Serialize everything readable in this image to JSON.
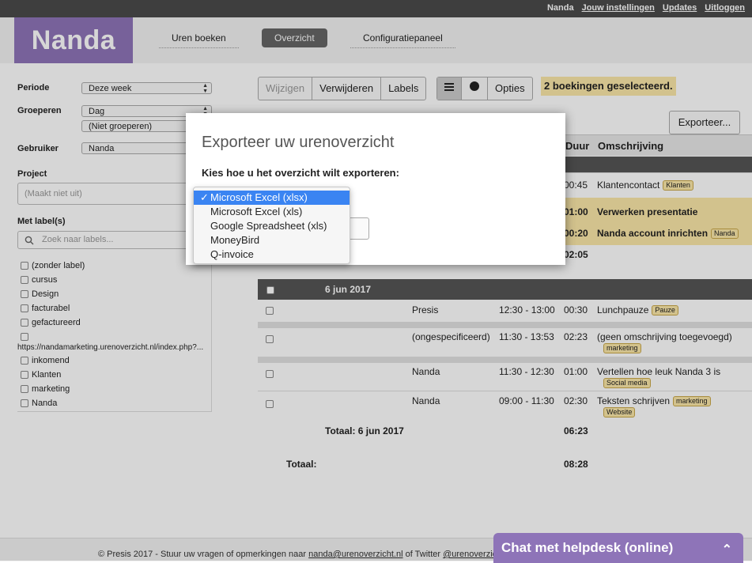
{
  "topbar": {
    "user": "Nanda",
    "settings": "Jouw instellingen",
    "updates": "Updates",
    "logout": "Uitloggen"
  },
  "logo": "Nanda",
  "nav": {
    "book_hours": "Uren boeken",
    "overview": "Overzicht",
    "config": "Configuratiepaneel"
  },
  "filters": {
    "period_label": "Periode",
    "period_value": "Deze week",
    "group_label": "Groeperen",
    "group_value": "Dag",
    "group_value2": "(Niet groeperen)",
    "user_label": "Gebruiker",
    "user_value": "Nanda",
    "project_label": "Project",
    "project_placeholder": "(Maakt niet uit)",
    "labels_label": "Met label(s)",
    "labels_placeholder": "Zoek naar labels...",
    "label_items": [
      "(zonder label)",
      "cursus",
      "Design",
      "facturabel",
      "gefactureerd",
      "",
      "https://nandamarketing.urenoverzicht.nl/index.php?...",
      "inkomend",
      "Klanten",
      "marketing",
      "Nanda"
    ]
  },
  "toolbar": {
    "edit": "Wijzigen",
    "delete": "Verwijderen",
    "labels": "Labels",
    "options": "Opties",
    "notice": "2 boekingen geselecteerd.",
    "export": "Exporteer..."
  },
  "table": {
    "col_duration": "Duur",
    "col_description": "Omschrijving",
    "group1_rows": [
      {
        "duration": "00:45",
        "description": "Klantencontact",
        "tag": "Klanten"
      },
      {
        "duration": "01:00",
        "description": "Verwerken presentatie",
        "tag": ""
      },
      {
        "duration": "00:20",
        "description": "Nanda account inrichten",
        "tag": "Nanda"
      }
    ],
    "group1_total": "02:05",
    "group2_date": "6 jun 2017",
    "group2_rows": [
      {
        "user": "Presis",
        "time": "12:30 - 13:00",
        "duration": "00:30",
        "description": "Lunchpauze",
        "tag": "Pauze"
      },
      {
        "user": "(ongespecificeerd)",
        "time": "11:30 - 13:53",
        "duration": "02:23",
        "description": "(geen omschrijving toegevoegd)",
        "tag": "marketing"
      },
      {
        "user": "Nanda",
        "time": "11:30 - 12:30",
        "duration": "01:00",
        "description": "Vertellen hoe leuk Nanda 3 is",
        "tag": "Social media"
      },
      {
        "user": "Nanda",
        "time": "09:00 - 11:30",
        "duration": "02:30",
        "description": "Teksten schrijven",
        "tag": "marketing",
        "tag2": "Website"
      }
    ],
    "group2_total_label": "Totaal: 6 jun 2017",
    "group2_total": "06:23",
    "grand_total_label": "Totaal:",
    "grand_total": "08:28"
  },
  "footer": {
    "prefix": "© Presis 2017 - Stuur uw vragen of opmerkingen naar",
    "email": "nanda@urenoverzicht.nl",
    "middle": "of Twitter",
    "twitter": "@urenoverzicht."
  },
  "modal": {
    "title": "Exporteer uw urenoverzicht",
    "subtitle": "Kies hoe u het overzicht wilt exporteren:",
    "options": [
      "Microsoft Excel (xlsx)",
      "Microsoft Excel (xls)",
      "Google Spreadsheet (xls)",
      "MoneyBird",
      "Q-invoice"
    ],
    "selected_mark": "✓"
  },
  "chat": {
    "label": "Chat met helpdesk (online)",
    "toggle": "⌃"
  },
  "colors": {
    "brand": "#8e74b8",
    "highlight": "#fbe7a8",
    "select_blue": "#3a84f2"
  }
}
